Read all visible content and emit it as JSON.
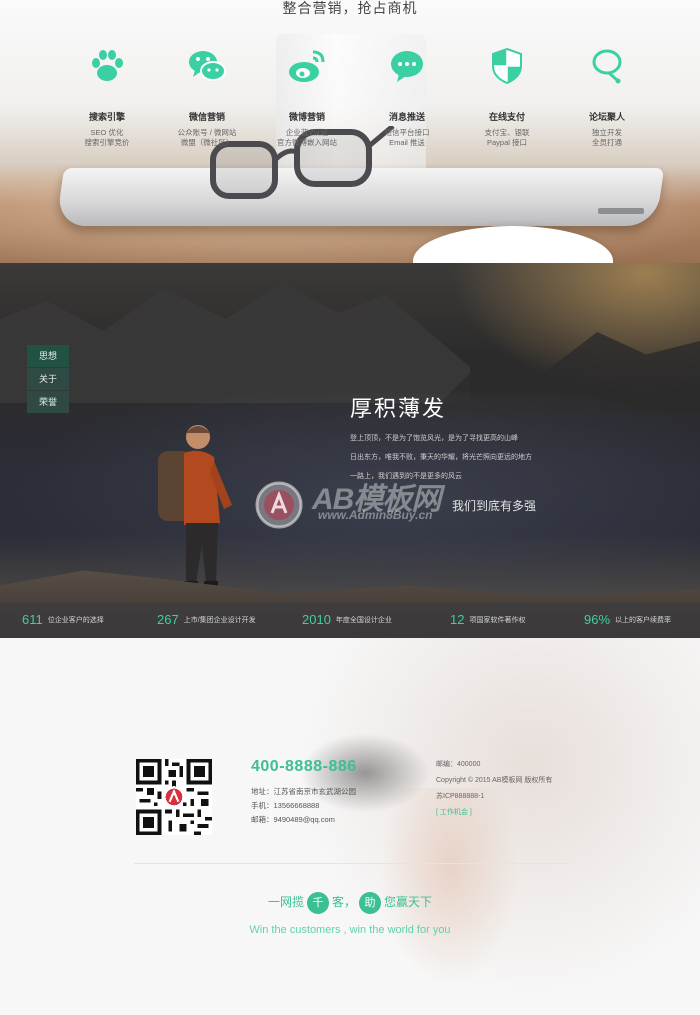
{
  "marketing": {
    "title": "整合营销，抢占商机",
    "features": [
      {
        "icon": "paw-icon",
        "name": "搜索引擎",
        "lines": [
          "SEO 优化",
          "搜索引擎竞价"
        ]
      },
      {
        "icon": "wechat-icon",
        "name": "微信营销",
        "lines": [
          "公众账号 / 微网站",
          "微盟（微社区）"
        ]
      },
      {
        "icon": "weibo-icon",
        "name": "微博营销",
        "lines": [
          "企业蓝V认证",
          "官方微博嵌入网站"
        ]
      },
      {
        "icon": "chat-bubble-icon",
        "name": "消息推送",
        "lines": [
          "短信平台接口",
          "Email 推送"
        ]
      },
      {
        "icon": "shield-icon",
        "name": "在线支付",
        "lines": [
          "支付宝、银联",
          "Paypal 接口"
        ]
      },
      {
        "icon": "forum-icon",
        "name": "论坛聚人",
        "lines": [
          "独立开发",
          "全员打通"
        ]
      }
    ],
    "accent": "#3bd0a4"
  },
  "about": {
    "nav": [
      "思想",
      "关于",
      "荣誉"
    ],
    "title": "厚积薄发",
    "paragraph": [
      "登上顶顶，不是为了饱览风光，是为了寻找更高的山峰",
      "日出东方，唯我不败，秉天的华耀，将光芒照向更远的地方",
      "一路上，我们遇到的不是更多的风云"
    ],
    "slogan": "我们到底有多强",
    "watermark": {
      "brand": "AB模板网",
      "url": "www.Admin8Buy.cn"
    },
    "stats": [
      {
        "number": "611",
        "label": "位企业客户的选择"
      },
      {
        "number": "267",
        "label": "上市/集团企业设计开发"
      },
      {
        "number": "2010",
        "label": "年度全国设计企业"
      },
      {
        "number": "12",
        "label": "项国家软件著作权"
      },
      {
        "number": "96%",
        "label": "以上的客户续费率"
      }
    ]
  },
  "contact": {
    "hotline": "400-8888-886",
    "address": "地址：江苏省南京市玄武湖公园",
    "mobile": "手机：13566668888",
    "email": "邮箱：9490489@qq.com",
    "postcode": "邮编：400000",
    "copyright": "Copyright © 2015 AB模板网 版权所有",
    "icp": "苏ICP888888-1",
    "jobs": "[ 工作机会 ]",
    "slogan_parts": {
      "pre": "一网揽",
      "c1": "千",
      "mid": "客，",
      "c2": "助",
      "post": "您赢天下"
    },
    "slogan_en": "Win the customers , win the world for you",
    "accent": "#3bbf95"
  }
}
